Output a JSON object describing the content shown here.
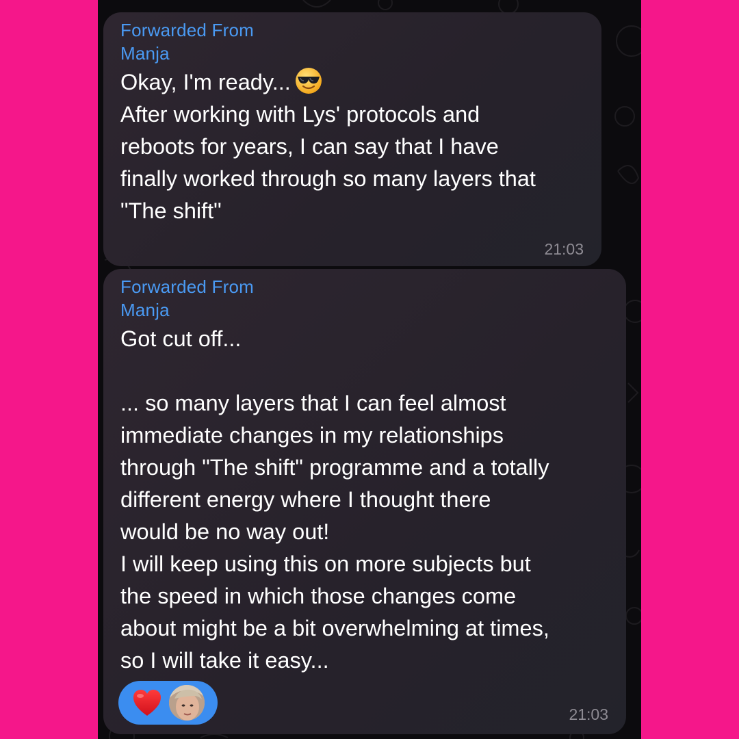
{
  "colors": {
    "background": "#f5178a",
    "chat_background": "#0c0b0e",
    "bubble": "#28232c",
    "forward_label": "#4a9af3",
    "message_text": "#ffffff",
    "timestamp": "#8e8b93",
    "reaction_pill": "#3b8df0",
    "heart": "#e8202a"
  },
  "messages": [
    {
      "forwarded_label": "Forwarded From",
      "forwarded_name": "Manja",
      "text_first_line": "Okay, I'm ready...",
      "emoji": "smiling-face-with-sunglasses-icon",
      "text": "\nAfter working with Lys' protocols and\nreboots for years, I can say that I have\nfinally worked through so many layers that\n\"The shift\"",
      "time": "21:03"
    },
    {
      "forwarded_label": "Forwarded From",
      "forwarded_name": "Manja",
      "text": "Got cut off...\n\n... so many layers that I can feel almost\nimmediate changes in my relationships\nthrough \"The shift\" programme and a totally\ndifferent energy where I thought there\nwould be no way out!\nI will keep using this on more subjects but\nthe speed in which those changes come\nabout might be a bit overwhelming at times,\nso I will take it easy...",
      "time": "21:03",
      "reactions": [
        {
          "icon": "red-heart-icon"
        },
        {
          "icon": "user-avatar-icon"
        }
      ]
    }
  ]
}
